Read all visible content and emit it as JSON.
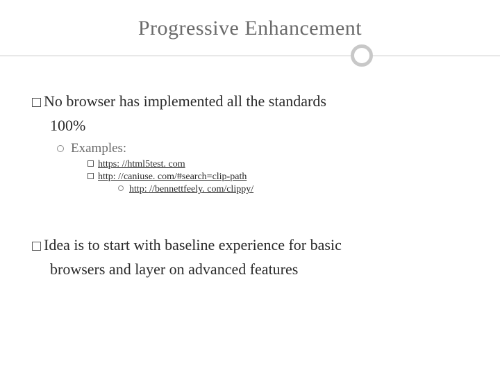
{
  "title": "Progressive Enhancement",
  "points": {
    "p1": "No browser has implemented all the standards",
    "p1b": "100%",
    "examples_label": "Examples:",
    "links": {
      "l1": "https: //html5test. com",
      "l2": "http: //caniuse. com/#search=clip-path",
      "l3": "http: //bennettfeely. com/clippy/"
    },
    "p2a": "Idea is to start with baseline experience for basic",
    "p2b": "browsers and layer on advanced features"
  }
}
